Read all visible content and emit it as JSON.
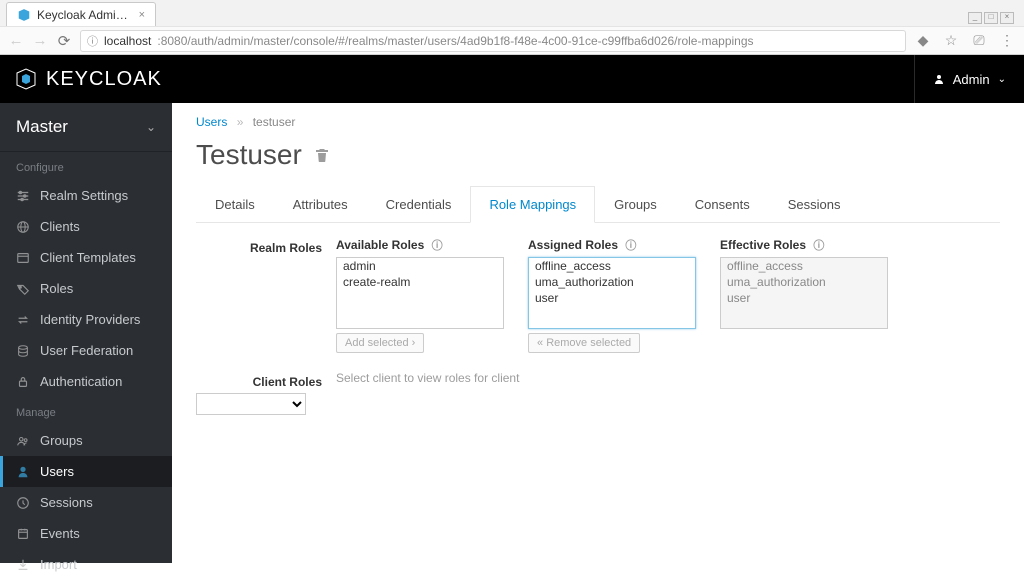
{
  "browser": {
    "tab_title": "Keycloak Admin Con…",
    "url_host": "localhost",
    "url_path": ":8080/auth/admin/master/console/#/realms/master/users/4ad9b1f8-f48e-4c00-91ce-c99ffba6d026/role-mappings",
    "win_min": "_",
    "win_max": "□",
    "win_close": "×"
  },
  "header": {
    "brand": "KEYCLOAK",
    "user_label": "Admin"
  },
  "sidebar": {
    "realm": "Master",
    "section_configure": "Configure",
    "section_manage": "Manage",
    "configure_items": [
      {
        "label": "Realm Settings"
      },
      {
        "label": "Clients"
      },
      {
        "label": "Client Templates"
      },
      {
        "label": "Roles"
      },
      {
        "label": "Identity Providers"
      },
      {
        "label": "User Federation"
      },
      {
        "label": "Authentication"
      }
    ],
    "manage_items": [
      {
        "label": "Groups"
      },
      {
        "label": "Users"
      },
      {
        "label": "Sessions"
      },
      {
        "label": "Events"
      },
      {
        "label": "Import"
      }
    ],
    "active": "Users"
  },
  "breadcrumb": {
    "root": "Users",
    "current": "testuser"
  },
  "page": {
    "title": "Testuser"
  },
  "tabs": [
    "Details",
    "Attributes",
    "Credentials",
    "Role Mappings",
    "Groups",
    "Consents",
    "Sessions"
  ],
  "active_tab": "Role Mappings",
  "realm_roles": {
    "label": "Realm Roles",
    "available_title": "Available Roles",
    "assigned_title": "Assigned Roles",
    "effective_title": "Effective Roles",
    "available": [
      "admin",
      "create-realm"
    ],
    "assigned": [
      "offline_access",
      "uma_authorization",
      "user"
    ],
    "effective": [
      "offline_access",
      "uma_authorization",
      "user"
    ],
    "add_btn": "Add selected",
    "remove_btn": "Remove selected"
  },
  "client_roles": {
    "label": "Client Roles",
    "hint": "Select client to view roles for client"
  }
}
